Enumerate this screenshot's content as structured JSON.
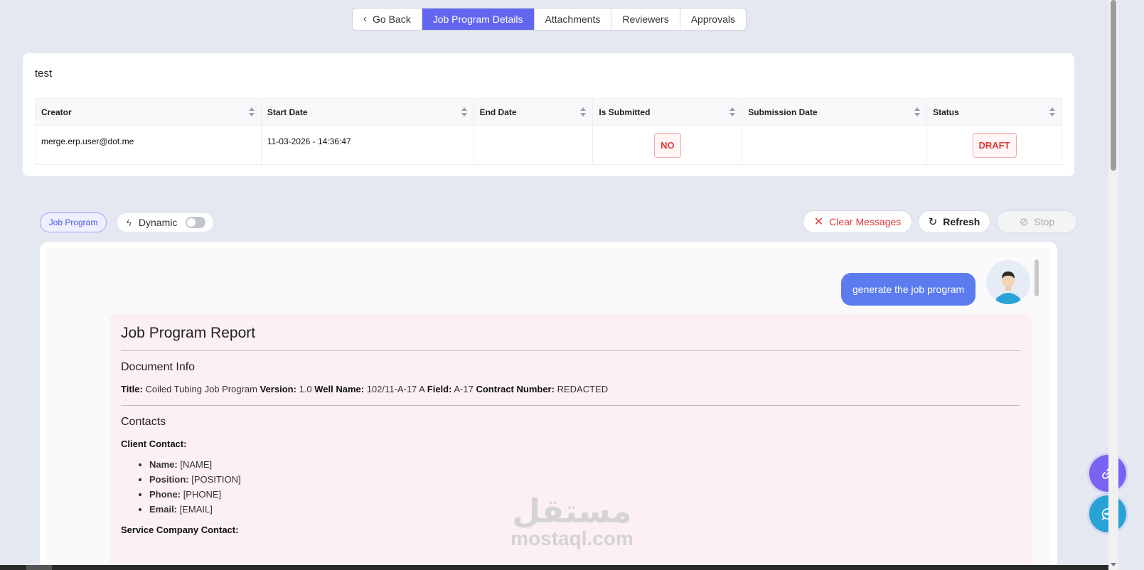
{
  "tabs": {
    "go_back": "Go Back",
    "details": "Job Program Details",
    "attachments": "Attachments",
    "reviewers": "Reviewers",
    "approvals": "Approvals"
  },
  "card": {
    "title": "test",
    "columns": [
      "Creator",
      "Start Date",
      "End Date",
      "Is Submitted",
      "Submission Date",
      "Status"
    ],
    "row": {
      "creator": "merge.erp.user@dot.me",
      "start_date": "11-03-2026 - 14:36:47",
      "end_date": "",
      "is_submitted": "NO",
      "submission_date": "",
      "status": "DRAFT"
    }
  },
  "toolbar": {
    "job_program": "Job Program",
    "dynamic": "Dynamic",
    "dynamic_enabled": false,
    "clear_messages": "Clear Messages",
    "refresh": "Refresh",
    "stop": "Stop"
  },
  "chat": {
    "user_message": "generate the job program",
    "report": {
      "title": "Job Program Report",
      "document_info_heading": "Document Info",
      "doc_info": {
        "title_label": "Title:",
        "title": "Coiled Tubing Job Program",
        "version_label": "Version:",
        "version": "1.0",
        "well_label": "Well Name:",
        "well": "102/11-A-17 A",
        "field_label": "Field:",
        "field": "A-17",
        "contract_label": "Contract Number:",
        "contract": "REDACTED"
      },
      "contacts_heading": "Contacts",
      "client_contact_label": "Client Contact:",
      "client_contact": [
        {
          "label": "Name:",
          "value": "[NAME]"
        },
        {
          "label": "Position:",
          "value": "[POSITION]"
        },
        {
          "label": "Phone:",
          "value": "[PHONE]"
        },
        {
          "label": "Email:",
          "value": "[EMAIL]"
        }
      ],
      "service_contact_label": "Service Company Contact:"
    }
  },
  "watermark": {
    "arabic": "مستقل",
    "latin": "mostaql.com"
  },
  "colors": {
    "accent": "#6366f1",
    "danger": "#e03a3a",
    "user_bubble": "#5b7bef",
    "report_bg": "#fcf0f6"
  },
  "icons": {
    "back": "chevron-left-icon",
    "bolt": "bolt-icon",
    "clear": "x-icon",
    "refresh": "refresh-icon",
    "stop": "stop-icon",
    "link": "link-icon",
    "chat": "chat-icon"
  }
}
